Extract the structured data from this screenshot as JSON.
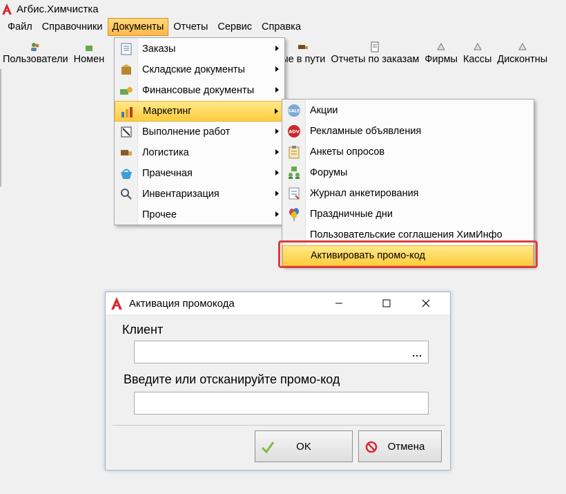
{
  "window": {
    "title": "Агбис.Химчистка"
  },
  "menubar": {
    "items": [
      {
        "label": "Файл"
      },
      {
        "label": "Справочники"
      },
      {
        "label": "Документы"
      },
      {
        "label": "Отчеты"
      },
      {
        "label": "Сервис"
      },
      {
        "label": "Справка"
      }
    ]
  },
  "toolbar": {
    "items": [
      {
        "label": "Пользователи"
      },
      {
        "label": "Номен"
      },
      {
        "label": "ые в пути"
      },
      {
        "label": "Отчеты по заказам"
      },
      {
        "label": "Фирмы"
      },
      {
        "label": "Кассы"
      },
      {
        "label": "Дисконтны"
      }
    ]
  },
  "documents_menu": {
    "items": [
      {
        "label": "Заказы"
      },
      {
        "label": "Складские документы"
      },
      {
        "label": "Финансовые документы"
      },
      {
        "label": "Маркетинг"
      },
      {
        "label": "Выполнение работ"
      },
      {
        "label": "Логистика"
      },
      {
        "label": "Прачечная"
      },
      {
        "label": "Инвентаризация"
      },
      {
        "label": "Прочее"
      }
    ]
  },
  "marketing_menu": {
    "items": [
      {
        "label": "Акции",
        "icon_text": "SALE"
      },
      {
        "label": "Рекламные объявления",
        "icon_text": "ADV"
      },
      {
        "label": "Анкеты опросов"
      },
      {
        "label": "Форумы"
      },
      {
        "label": "Журнал анкетирования"
      },
      {
        "label": "Праздничные дни"
      },
      {
        "label": "Пользовательские соглашения ХимИнфо"
      },
      {
        "label": "Активировать промо-код"
      }
    ]
  },
  "dialog": {
    "title": "Активация промокода",
    "client_label": "Клиент",
    "client_value": "",
    "client_button": "...",
    "promo_label": "Введите или отсканируйте промо-код",
    "promo_value": "",
    "ok_label": "OK",
    "cancel_label": "Отмена"
  },
  "colors": {
    "highlight": "#ffcd3c",
    "active_menu": "#ffb84d",
    "callout_border": "#e03b3b",
    "app_logo": "#d9272e"
  }
}
